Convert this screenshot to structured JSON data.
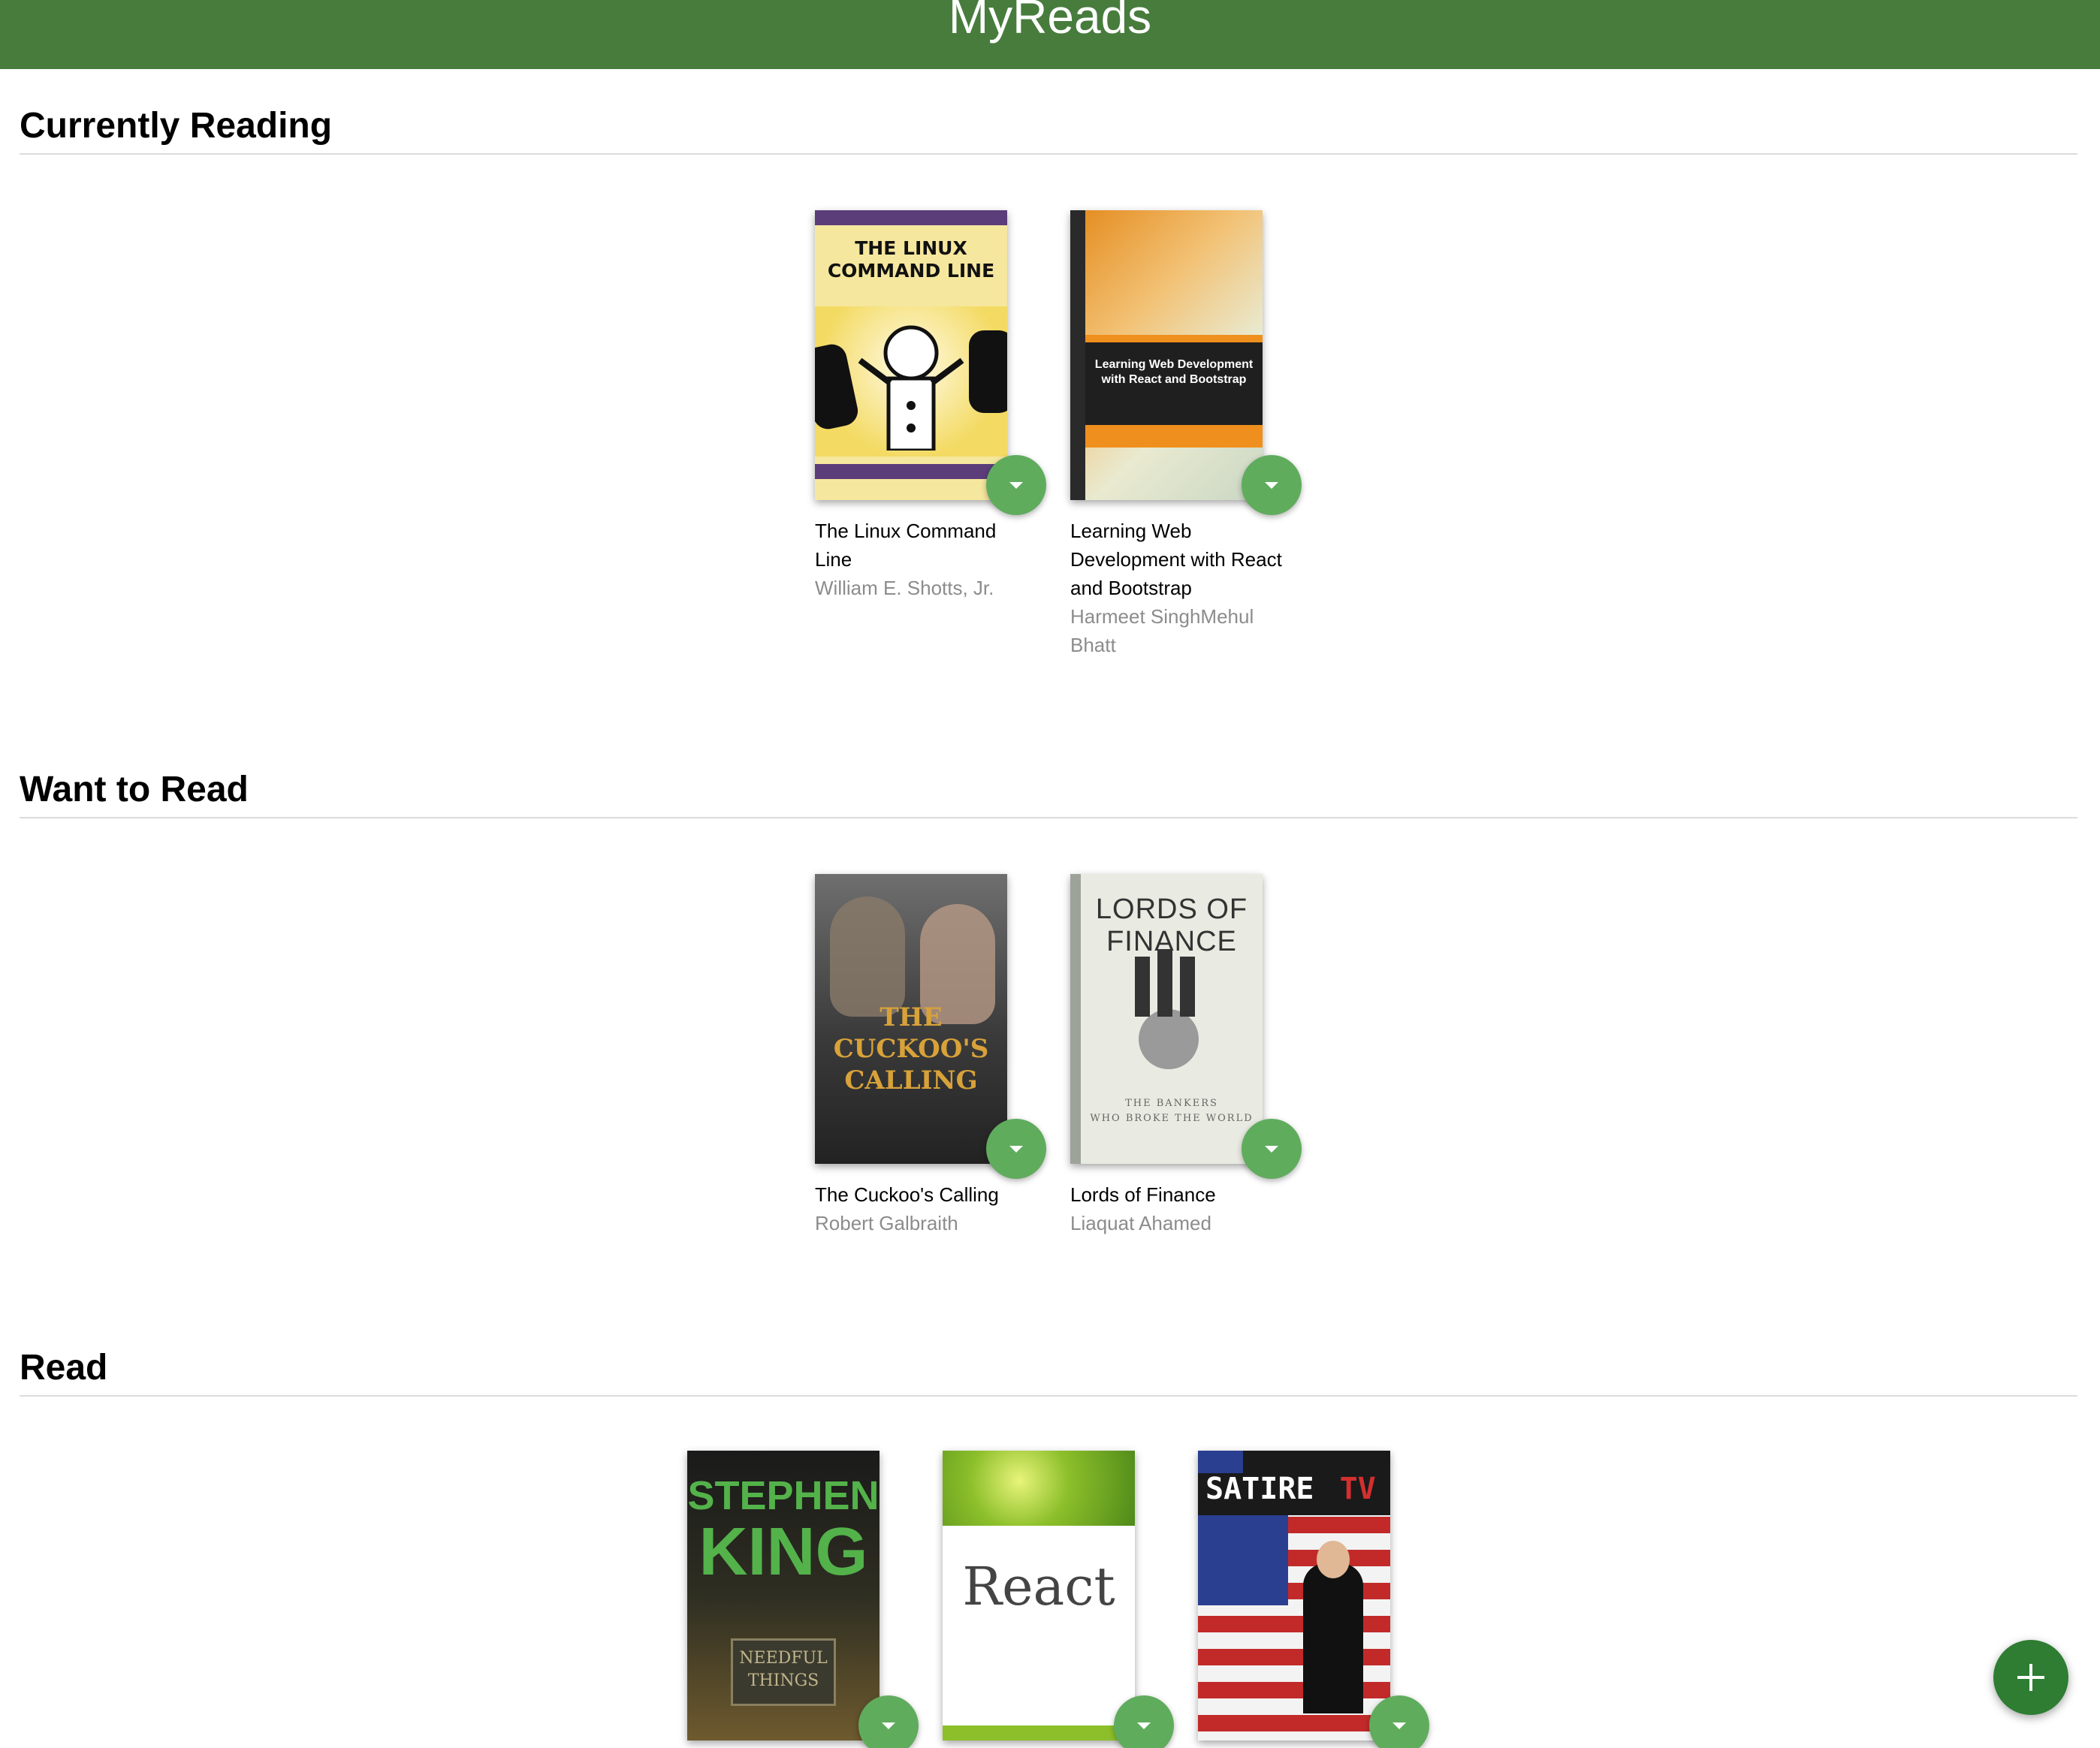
{
  "app": {
    "title": "MyReads"
  },
  "colors": {
    "header": "#477c3d",
    "shelf_changer": "#60ac5d",
    "add_button": "#2e7d32",
    "author_text": "#8c8c8c"
  },
  "shelves": [
    {
      "title": "Currently Reading",
      "books": [
        {
          "title": "The Linux Command Line",
          "authors": "William E. Shotts, Jr.",
          "cover_text": [
            "THE LINUX",
            "COMMAND LINE"
          ]
        },
        {
          "title": "Learning Web Development with React and Bootstrap",
          "authors": "Harmeet SinghMehul Bhatt",
          "cover_text": [
            "Learning Web Development",
            "with React and Bootstrap"
          ]
        }
      ]
    },
    {
      "title": "Want to Read",
      "books": [
        {
          "title": "The Cuckoo's Calling",
          "authors": "Robert Galbraith",
          "cover_text": [
            "THE",
            "CUCKOO'S",
            "CALLING"
          ]
        },
        {
          "title": "Lords of Finance",
          "authors": "Liaquat Ahamed",
          "cover_text": [
            "LORDS OF FINANCE",
            "THE BANKERS",
            "WHO BROKE THE WORLD"
          ]
        }
      ]
    },
    {
      "title": "Read",
      "books": [
        {
          "cover_text": [
            "STEPHEN",
            "KING",
            "NEEDFUL",
            "THINGS"
          ]
        },
        {
          "cover_text": [
            "React"
          ]
        },
        {
          "cover_text": [
            "SATIRE",
            "TV"
          ]
        }
      ]
    }
  ],
  "icons": {
    "shelf_changer": "arrow-drop-down-icon",
    "add": "plus-icon"
  }
}
